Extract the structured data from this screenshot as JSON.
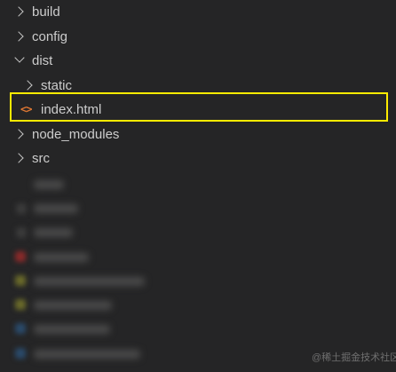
{
  "explorer": {
    "items": [
      {
        "label": "build",
        "type": "folder",
        "expanded": false
      },
      {
        "label": "config",
        "type": "folder",
        "expanded": false
      },
      {
        "label": "dist",
        "type": "folder",
        "expanded": true
      },
      {
        "label": "static",
        "type": "folder",
        "expanded": false
      },
      {
        "label": "index.html",
        "type": "file",
        "icon": "html-file-icon",
        "selected": true
      },
      {
        "label": "node_modules",
        "type": "folder",
        "expanded": false
      },
      {
        "label": "src",
        "type": "folder",
        "expanded": false
      }
    ],
    "file_icon_glyph": "<>"
  },
  "colors": {
    "background": "#252526",
    "text": "#cccccc",
    "highlight": "#ffeb00",
    "html_icon": "#e37933"
  },
  "watermark": "@稀土掘金技术社区"
}
